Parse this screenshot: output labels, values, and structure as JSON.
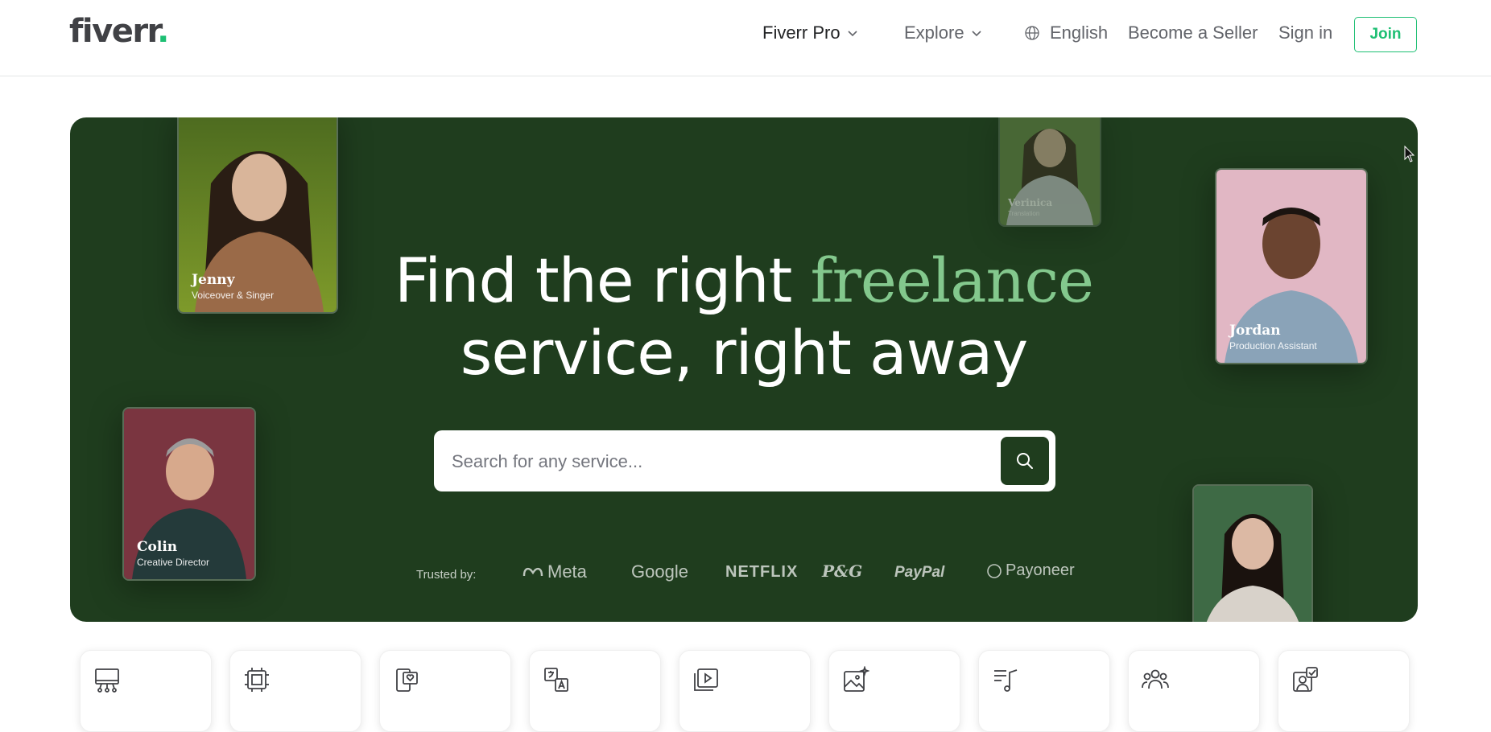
{
  "header": {
    "logo_text": "fiverr",
    "logo_dot": ".",
    "nav": {
      "fiverr_pro": "Fiverr Pro",
      "explore": "Explore",
      "language": "English",
      "become_seller": "Become a Seller",
      "sign_in": "Sign in",
      "join": "Join"
    }
  },
  "hero": {
    "title_line1_prefix": "Find the right ",
    "title_line1_accent": "freelance",
    "title_line2": "service, right away",
    "search": {
      "placeholder": "Search for any service..."
    },
    "trusted_label": "Trusted by:",
    "brands": [
      "Meta",
      "Google",
      "NETFLIX",
      "P&G",
      "PayPal",
      "Payoneer"
    ],
    "freelancers": [
      {
        "name": "Jenny",
        "role": "Voiceover & Singer"
      },
      {
        "name": "Colin",
        "role": "Creative Director"
      },
      {
        "name": "Verinica",
        "role": "Translation"
      },
      {
        "name": "Jordan",
        "role": "Production Assistant"
      }
    ]
  },
  "categories": [
    {
      "icon": "presentation-icon"
    },
    {
      "icon": "ai-chip-icon"
    },
    {
      "icon": "mobile-heart-icon"
    },
    {
      "icon": "translate-icon"
    },
    {
      "icon": "video-play-icon"
    },
    {
      "icon": "image-sparkle-icon"
    },
    {
      "icon": "music-notes-icon"
    },
    {
      "icon": "people-group-icon"
    },
    {
      "icon": "profile-check-icon"
    }
  ],
  "colors": {
    "brand_green": "#1dbf73",
    "hero_bg": "#1f3d1e",
    "accent_text": "#83c88d"
  }
}
